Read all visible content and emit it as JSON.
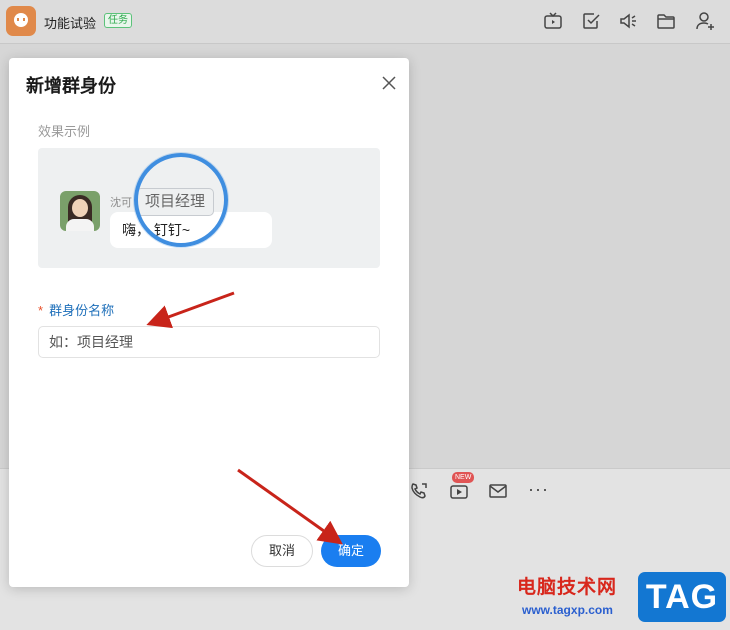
{
  "header": {
    "title": "功能试验",
    "badge": "任务",
    "icons": [
      "tv-icon",
      "checkbox-icon",
      "speaker-icon",
      "folder-icon",
      "add-member-icon"
    ]
  },
  "input_toolbar": {
    "icons": [
      "phone-icon",
      "live-icon",
      "mail-icon",
      "more-icon"
    ],
    "new_badge": "NEW",
    "more": "···"
  },
  "dialog": {
    "title": "新增群身份",
    "example_label": "效果示例",
    "example": {
      "sender_name": "沈可",
      "identity_tag": "项目经理",
      "message": "嗨，          钉钉~"
    },
    "field_label": "群身份名称",
    "field_required_mark": "*",
    "input_placeholder": "如：项目经理",
    "input_value": "",
    "cancel_label": "取消",
    "confirm_label": "确定"
  },
  "watermark": {
    "text": "电脑技术网",
    "url": "www.tagxp.com",
    "logo": "TAG"
  },
  "colors": {
    "accent": "#1a7ef0",
    "annotation": "#d8271c",
    "magnifier": "#3f8ee0",
    "badge_green": "#2aa84a"
  }
}
